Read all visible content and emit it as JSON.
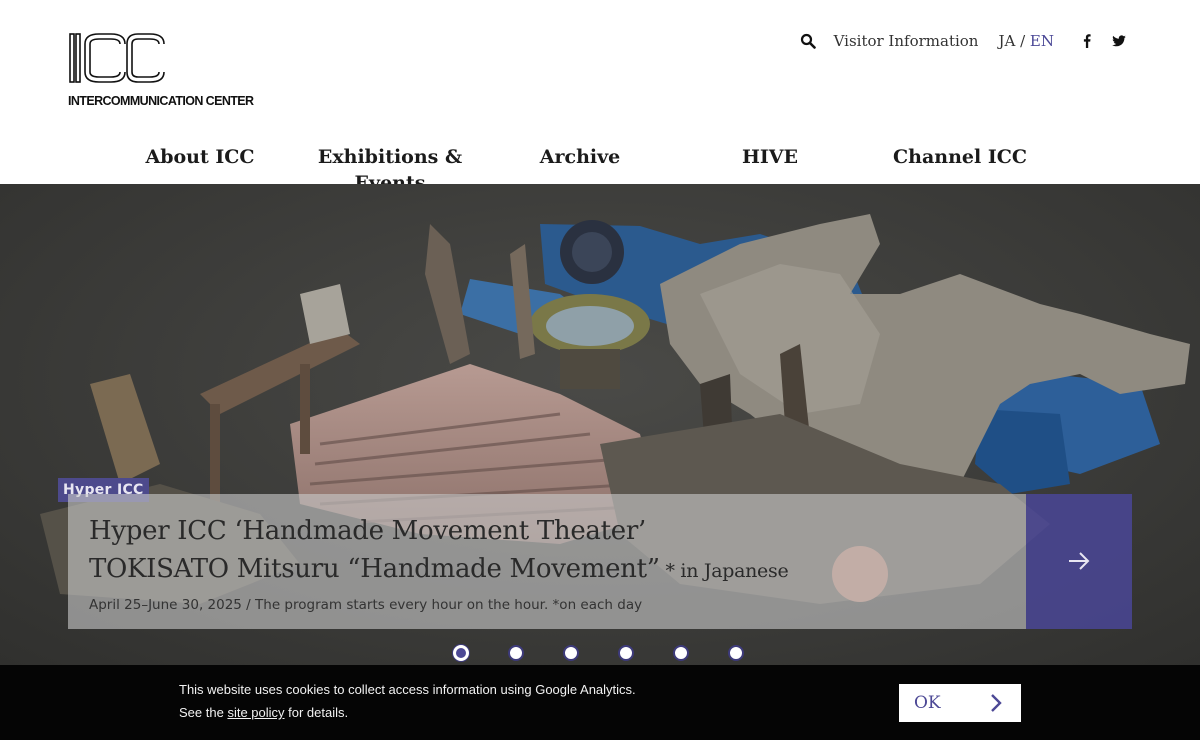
{
  "header": {
    "logo_sub": "INTERCOMMUNICATION CENTER",
    "visitor_info": "Visitor Information",
    "lang_ja": "JA",
    "lang_sep": " / ",
    "lang_en": "EN",
    "icons": [
      "search-icon",
      "facebook-icon",
      "twitter-icon"
    ]
  },
  "nav": {
    "items": [
      {
        "label": "About ICC"
      },
      {
        "label": "Exhibitions & Events"
      },
      {
        "label": "Archive"
      },
      {
        "label": "HIVE"
      },
      {
        "label": "Channel ICC"
      }
    ]
  },
  "hero": {
    "badge": "Hyper ICC",
    "title_line1": "Hyper ICC ‘Handmade Movement Theater’",
    "title_line2": "TOKISATO Mitsuru “Handmade Movement”",
    "title_suffix": " * in Japanese",
    "date": "April 25–June 30, 2025 / The program starts every hour on the hour. *on each day",
    "slide_count": 6,
    "active_slide": 1
  },
  "cookie": {
    "line1": "This website uses cookies to collect access information using Google Analytics.",
    "line2_pre": "See the ",
    "line2_link": "site policy",
    "line2_post": " for details.",
    "ok": "OK"
  },
  "colors": {
    "accent": "#4c4895",
    "banner_bg": "#050505",
    "hero_bg": "#3b3b39"
  }
}
